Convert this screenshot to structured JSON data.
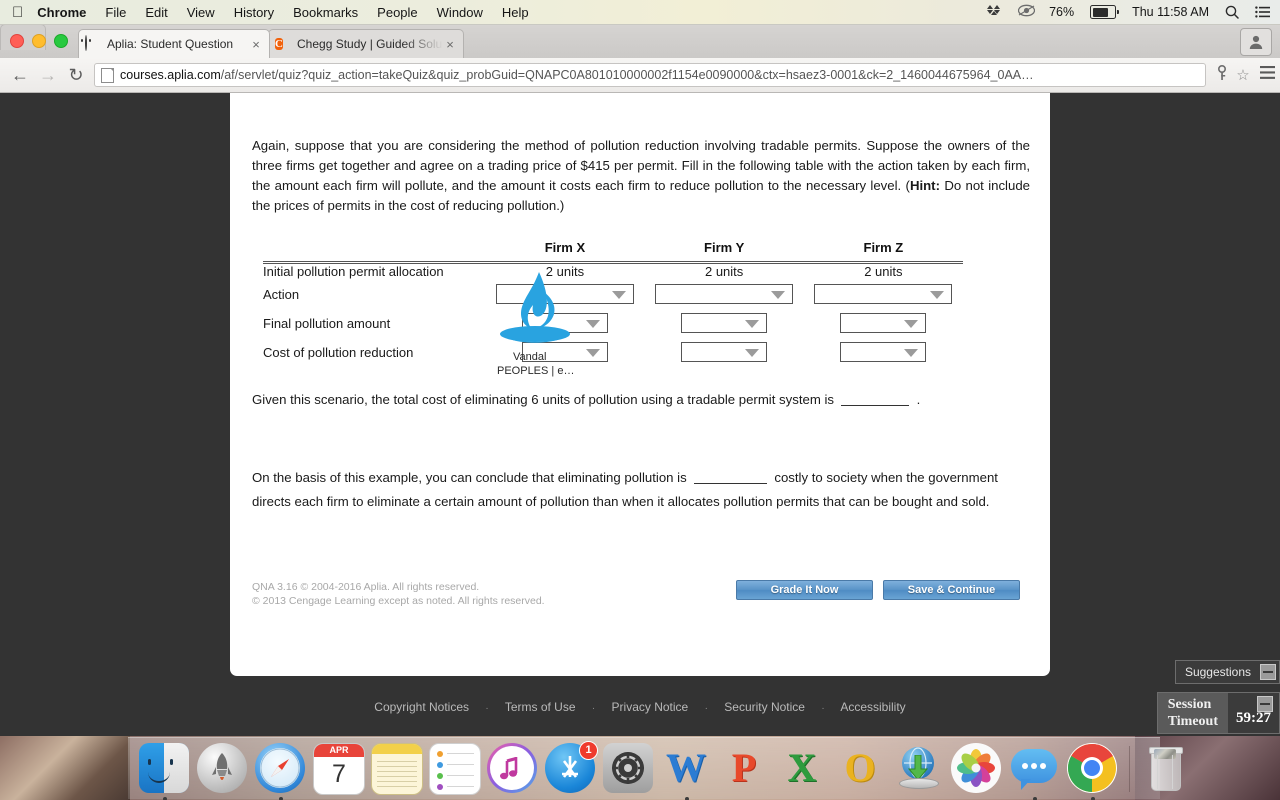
{
  "menubar": {
    "apple_icon": "apple-icon",
    "items": [
      {
        "label": "Chrome",
        "bold": true
      },
      {
        "label": "File",
        "bold": false
      },
      {
        "label": "Edit",
        "bold": false
      },
      {
        "label": "View",
        "bold": false
      },
      {
        "label": "History",
        "bold": false
      },
      {
        "label": "Bookmarks",
        "bold": false
      },
      {
        "label": "People",
        "bold": false
      },
      {
        "label": "Window",
        "bold": false
      },
      {
        "label": "Help",
        "bold": false
      }
    ],
    "status": {
      "dropbox_icon": "dropbox-icon",
      "eye_icon": "flux-eye-icon",
      "battery_percent": "76%",
      "battery_icon": "battery-icon",
      "clock": "Thu 11:58 AM",
      "search_icon": "spotlight-search-icon",
      "notifications_icon": "notification-center-icon"
    }
  },
  "browser": {
    "tabs": [
      {
        "title": "Aplia: Student Question",
        "favicon": "aplia-face-icon",
        "close": "×",
        "active": true
      },
      {
        "title": "Chegg Study | Guided Solu",
        "favicon": "chegg-icon",
        "close": "×",
        "active": false
      }
    ],
    "new_tab_label": "",
    "profile_icon": "profile-avatar-icon",
    "nav": {
      "back_icon": "back-arrow-icon",
      "forward_icon": "forward-arrow-icon",
      "reload_icon": "reload-icon",
      "menu_icon": "chrome-menu-icon",
      "password_icon": "password-key-icon",
      "bookmark_icon": "bookmark-star-icon"
    },
    "address": {
      "page_icon": "page-document-icon",
      "domain": "courses.aplia.com",
      "path": "/af/servlet/quiz?quiz_action=takeQuiz&quiz_probGuid=QNAPC0A801010000002f1154e0090000&ctx=hsaez3-0001&ck=2_1460044675964_0AA…"
    }
  },
  "page": {
    "question_text_part1": "Again, suppose that you are considering the method of pollution reduction involving tradable permits. Suppose the owners of the three firms get together and agree on a trading price of $415 per permit. Fill in the following table with the action taken by each firm, the amount each firm will pollute, and the amount it costs each firm to reduce pollution to the necessary level. (",
    "question_hint_label": "Hint:",
    "question_text_part2": " Do not include the prices of permits in the cost of reducing pollution.)",
    "table": {
      "header": [
        "",
        "Firm X",
        "Firm Y",
        "Firm Z"
      ],
      "rows": [
        {
          "label": "Initial pollution permit allocation",
          "type": "text",
          "values": [
            "2 units",
            "2 units",
            "2 units"
          ]
        },
        {
          "label": "Action",
          "type": "select-wide",
          "values": [
            "",
            "",
            ""
          ]
        },
        {
          "label": "Final pollution amount",
          "type": "select-narrow",
          "values": [
            "",
            "",
            ""
          ]
        },
        {
          "label": "Cost of pollution reduction",
          "type": "select-narrow",
          "values": [
            "",
            "",
            ""
          ]
        }
      ]
    },
    "statement1_before": "Given this scenario, the total cost of eliminating 6 units of pollution using a tradable permit system is",
    "statement1_blank": "",
    "statement1_after": ".",
    "statement2_before": "On the basis of this example, you can conclude that eliminating pollution is",
    "statement2_blank": "",
    "statement2_after": "costly to society when the government directs each firm to eliminate a certain amount of pollution than when it allocates pollution permits that can be bought and sold.",
    "copyright_line1": "QNA 3.16 © 2004-2016 Aplia. All rights reserved.",
    "copyright_line2": "© 2013 Cengage Learning except as noted. All rights reserved.",
    "buttons": {
      "grade": "Grade It Now",
      "save": "Save & Continue"
    }
  },
  "overlay": {
    "logo_icon": "vandal-flame-logo-icon",
    "line1": "Vandal",
    "line2": "PEOPLES | e…"
  },
  "site_footer": {
    "links": [
      "Copyright Notices",
      "Terms of Use",
      "Privacy Notice",
      "Security Notice",
      "Accessibility"
    ],
    "separator": "·"
  },
  "widgets": {
    "suggestions": {
      "label": "Suggestions",
      "minimize_icon": "minimize-icon"
    },
    "session_timeout": {
      "label_line1": "Session",
      "label_line2": "Timeout",
      "time": "59:27",
      "minimize_icon": "minimize-icon"
    }
  },
  "dock": {
    "items": [
      {
        "name": "finder",
        "label": "Finder",
        "running": true
      },
      {
        "name": "launchpad",
        "label": "Launchpad",
        "running": false
      },
      {
        "name": "safari",
        "label": "Safari",
        "running": true
      },
      {
        "name": "calendar",
        "label": "Calendar",
        "running": false,
        "month": "APR",
        "day": "7"
      },
      {
        "name": "notes",
        "label": "Notes",
        "running": false
      },
      {
        "name": "reminders",
        "label": "Reminders",
        "running": false
      },
      {
        "name": "itunes",
        "label": "iTunes",
        "running": false
      },
      {
        "name": "app-store",
        "label": "App Store",
        "running": false,
        "badge": "1"
      },
      {
        "name": "system-preferences",
        "label": "System Preferences",
        "running": false
      },
      {
        "name": "word",
        "label": "Microsoft Word",
        "running": true
      },
      {
        "name": "powerpoint",
        "label": "Microsoft PowerPoint",
        "running": false
      },
      {
        "name": "excel",
        "label": "Microsoft Excel",
        "running": false
      },
      {
        "name": "outlook",
        "label": "Microsoft Outlook",
        "running": false
      },
      {
        "name": "downloader",
        "label": "Downloader",
        "running": false
      },
      {
        "name": "photos",
        "label": "Photos",
        "running": false
      },
      {
        "name": "messages",
        "label": "Messages",
        "running": true
      },
      {
        "name": "chrome",
        "label": "Google Chrome",
        "running": true
      },
      {
        "name": "trash",
        "label": "Trash",
        "running": false
      }
    ]
  }
}
